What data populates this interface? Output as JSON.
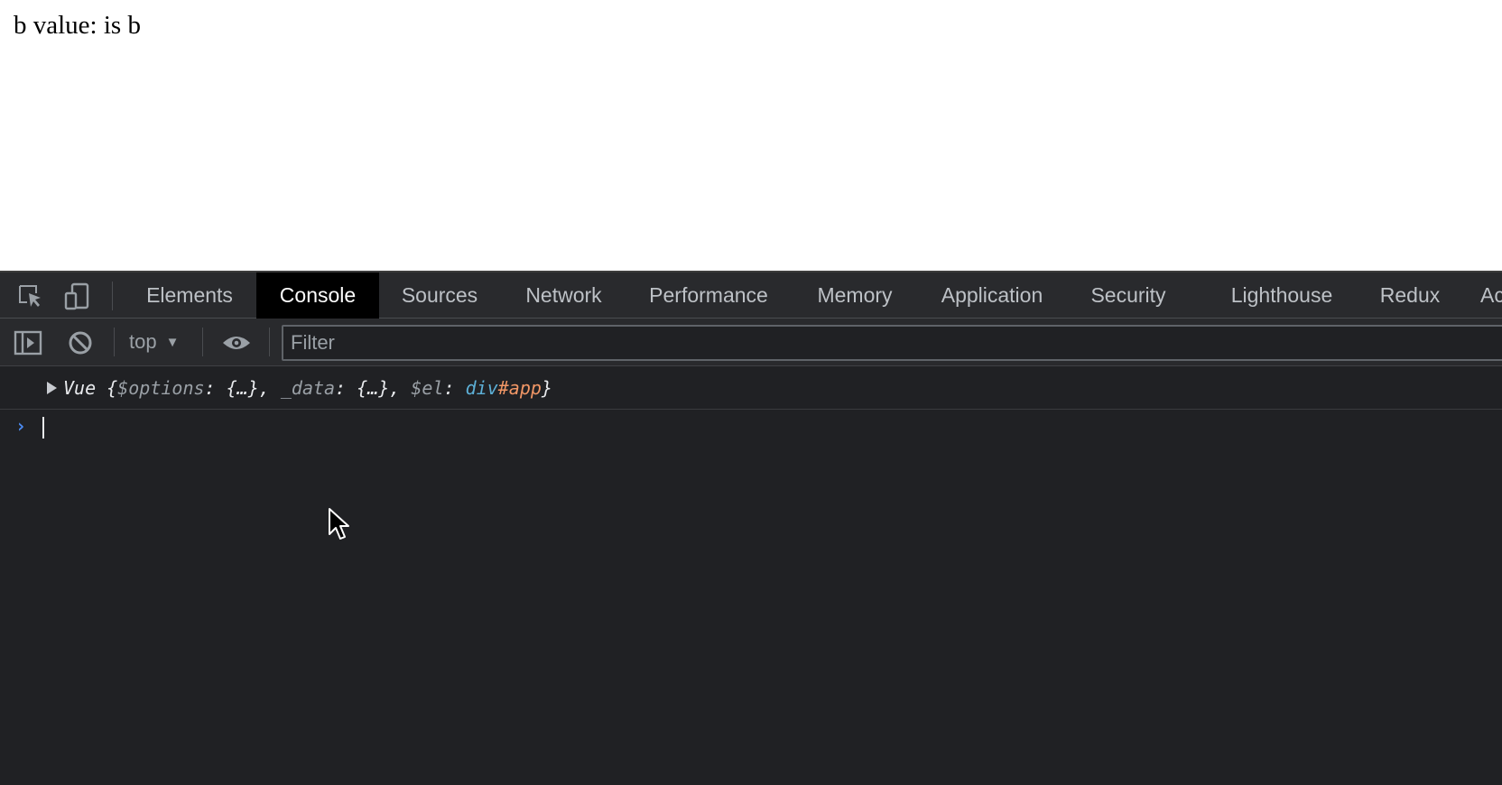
{
  "page": {
    "text": "b value: is b"
  },
  "devtools": {
    "tabs": [
      {
        "label": "Elements"
      },
      {
        "label": "Console"
      },
      {
        "label": "Sources"
      },
      {
        "label": "Network"
      },
      {
        "label": "Performance"
      },
      {
        "label": "Memory"
      },
      {
        "label": "Application"
      },
      {
        "label": "Security"
      },
      {
        "label": "Lighthouse"
      },
      {
        "label": "Redux"
      },
      {
        "label": "Ac"
      }
    ],
    "active_tab": "Console",
    "toolbar": {
      "context": "top",
      "filter_placeholder": "Filter"
    },
    "console": {
      "log": {
        "class_name": "Vue ",
        "open_brace": "{",
        "k1": "$options",
        "sep1": ": ",
        "v1": "{…}",
        "comma1": ", ",
        "k2": "_data",
        "sep2": ": ",
        "v2": "{…}",
        "comma2": ", ",
        "k3": "$el",
        "sep3": ": ",
        "v3_tag": "div",
        "v3_id": "#app",
        "close_brace": "}"
      },
      "prompt_symbol": "›"
    }
  },
  "colors": {
    "devtools_bg": "#202124",
    "active_tab_bg": "#000000",
    "tag_color": "#5db0d7",
    "id_color": "#f29766",
    "prompt_color": "#4c8df6"
  },
  "icons": [
    "inspect-element-icon",
    "device-toolbar-icon",
    "sidebar-toggle-icon",
    "clear-console-icon",
    "dropdown-caret-icon",
    "live-expression-eye-icon",
    "expand-arrow-icon",
    "mouse-cursor-icon"
  ]
}
